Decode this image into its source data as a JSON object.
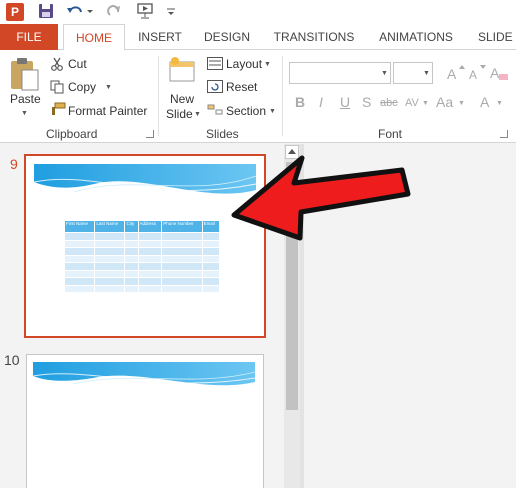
{
  "app": {
    "logo_text": "P"
  },
  "tabs": [
    "FILE",
    "HOME",
    "INSERT",
    "DESIGN",
    "TRANSITIONS",
    "ANIMATIONS",
    "SLIDE S"
  ],
  "clipboard": {
    "paste_label": "Paste",
    "cut_label": "Cut",
    "copy_label": "Copy",
    "format_painter_label": "Format Painter",
    "group_label": "Clipboard"
  },
  "slides_group": {
    "new_label_1": "New",
    "new_label_2": "Slide",
    "layout_label": "Layout",
    "reset_label": "Reset",
    "section_label": "Section",
    "group_label": "Slides"
  },
  "font_group": {
    "bold": "B",
    "italic": "I",
    "underline": "U",
    "shadow": "S",
    "strike": "abc",
    "spacing": "AV",
    "case": "Aa",
    "color": "A",
    "group_label": "Font"
  },
  "thumbnails": [
    {
      "number": "9",
      "selected": true
    },
    {
      "number": "10",
      "selected": false
    }
  ],
  "table": {
    "headers": [
      "First Name",
      "Last Name",
      "City",
      "Address",
      "Phone Number",
      "Email"
    ],
    "rows": 8
  },
  "colors": {
    "accent": "#d24726",
    "table_header": "#4fb3e8",
    "arrow": "#ee1c1c"
  }
}
